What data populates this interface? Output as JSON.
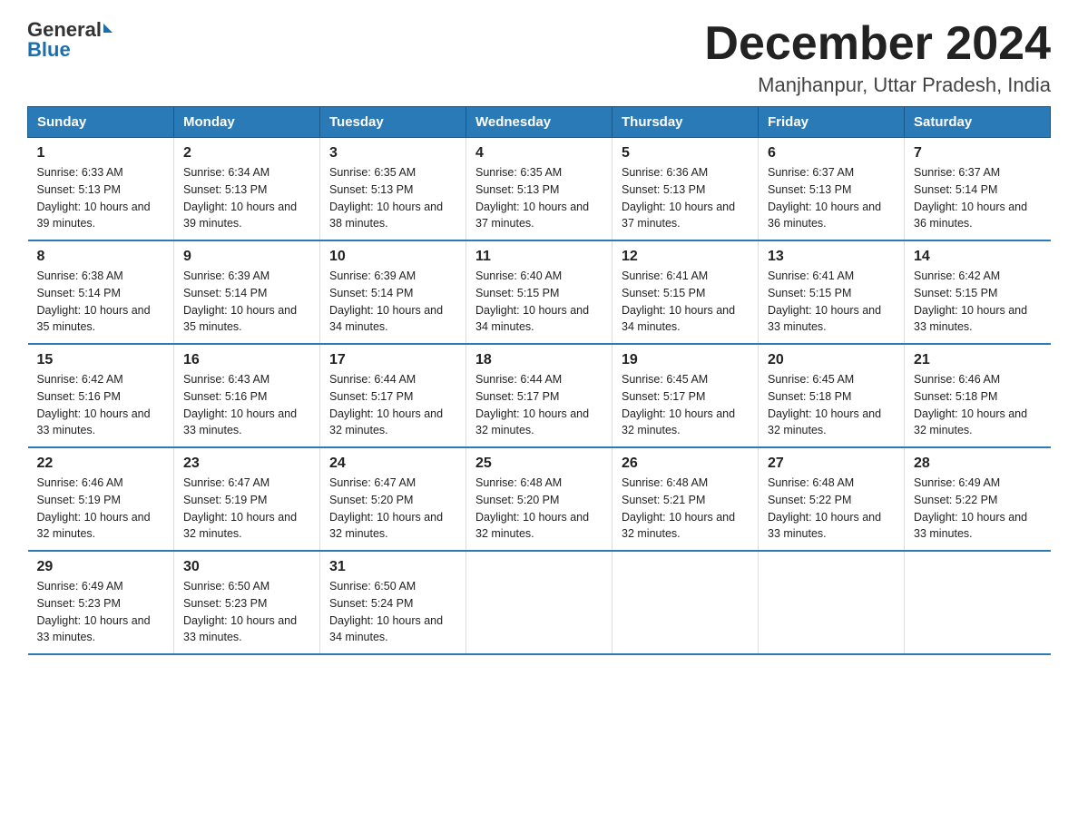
{
  "header": {
    "logo_general": "General",
    "logo_blue": "Blue",
    "month_title": "December 2024",
    "location": "Manjhanpur, Uttar Pradesh, India"
  },
  "days_of_week": [
    "Sunday",
    "Monday",
    "Tuesday",
    "Wednesday",
    "Thursday",
    "Friday",
    "Saturday"
  ],
  "weeks": [
    [
      {
        "day": "1",
        "sunrise": "6:33 AM",
        "sunset": "5:13 PM",
        "daylight": "10 hours and 39 minutes."
      },
      {
        "day": "2",
        "sunrise": "6:34 AM",
        "sunset": "5:13 PM",
        "daylight": "10 hours and 39 minutes."
      },
      {
        "day": "3",
        "sunrise": "6:35 AM",
        "sunset": "5:13 PM",
        "daylight": "10 hours and 38 minutes."
      },
      {
        "day": "4",
        "sunrise": "6:35 AM",
        "sunset": "5:13 PM",
        "daylight": "10 hours and 37 minutes."
      },
      {
        "day": "5",
        "sunrise": "6:36 AM",
        "sunset": "5:13 PM",
        "daylight": "10 hours and 37 minutes."
      },
      {
        "day": "6",
        "sunrise": "6:37 AM",
        "sunset": "5:13 PM",
        "daylight": "10 hours and 36 minutes."
      },
      {
        "day": "7",
        "sunrise": "6:37 AM",
        "sunset": "5:14 PM",
        "daylight": "10 hours and 36 minutes."
      }
    ],
    [
      {
        "day": "8",
        "sunrise": "6:38 AM",
        "sunset": "5:14 PM",
        "daylight": "10 hours and 35 minutes."
      },
      {
        "day": "9",
        "sunrise": "6:39 AM",
        "sunset": "5:14 PM",
        "daylight": "10 hours and 35 minutes."
      },
      {
        "day": "10",
        "sunrise": "6:39 AM",
        "sunset": "5:14 PM",
        "daylight": "10 hours and 34 minutes."
      },
      {
        "day": "11",
        "sunrise": "6:40 AM",
        "sunset": "5:15 PM",
        "daylight": "10 hours and 34 minutes."
      },
      {
        "day": "12",
        "sunrise": "6:41 AM",
        "sunset": "5:15 PM",
        "daylight": "10 hours and 34 minutes."
      },
      {
        "day": "13",
        "sunrise": "6:41 AM",
        "sunset": "5:15 PM",
        "daylight": "10 hours and 33 minutes."
      },
      {
        "day": "14",
        "sunrise": "6:42 AM",
        "sunset": "5:15 PM",
        "daylight": "10 hours and 33 minutes."
      }
    ],
    [
      {
        "day": "15",
        "sunrise": "6:42 AM",
        "sunset": "5:16 PM",
        "daylight": "10 hours and 33 minutes."
      },
      {
        "day": "16",
        "sunrise": "6:43 AM",
        "sunset": "5:16 PM",
        "daylight": "10 hours and 33 minutes."
      },
      {
        "day": "17",
        "sunrise": "6:44 AM",
        "sunset": "5:17 PM",
        "daylight": "10 hours and 32 minutes."
      },
      {
        "day": "18",
        "sunrise": "6:44 AM",
        "sunset": "5:17 PM",
        "daylight": "10 hours and 32 minutes."
      },
      {
        "day": "19",
        "sunrise": "6:45 AM",
        "sunset": "5:17 PM",
        "daylight": "10 hours and 32 minutes."
      },
      {
        "day": "20",
        "sunrise": "6:45 AM",
        "sunset": "5:18 PM",
        "daylight": "10 hours and 32 minutes."
      },
      {
        "day": "21",
        "sunrise": "6:46 AM",
        "sunset": "5:18 PM",
        "daylight": "10 hours and 32 minutes."
      }
    ],
    [
      {
        "day": "22",
        "sunrise": "6:46 AM",
        "sunset": "5:19 PM",
        "daylight": "10 hours and 32 minutes."
      },
      {
        "day": "23",
        "sunrise": "6:47 AM",
        "sunset": "5:19 PM",
        "daylight": "10 hours and 32 minutes."
      },
      {
        "day": "24",
        "sunrise": "6:47 AM",
        "sunset": "5:20 PM",
        "daylight": "10 hours and 32 minutes."
      },
      {
        "day": "25",
        "sunrise": "6:48 AM",
        "sunset": "5:20 PM",
        "daylight": "10 hours and 32 minutes."
      },
      {
        "day": "26",
        "sunrise": "6:48 AM",
        "sunset": "5:21 PM",
        "daylight": "10 hours and 32 minutes."
      },
      {
        "day": "27",
        "sunrise": "6:48 AM",
        "sunset": "5:22 PM",
        "daylight": "10 hours and 33 minutes."
      },
      {
        "day": "28",
        "sunrise": "6:49 AM",
        "sunset": "5:22 PM",
        "daylight": "10 hours and 33 minutes."
      }
    ],
    [
      {
        "day": "29",
        "sunrise": "6:49 AM",
        "sunset": "5:23 PM",
        "daylight": "10 hours and 33 minutes."
      },
      {
        "day": "30",
        "sunrise": "6:50 AM",
        "sunset": "5:23 PM",
        "daylight": "10 hours and 33 minutes."
      },
      {
        "day": "31",
        "sunrise": "6:50 AM",
        "sunset": "5:24 PM",
        "daylight": "10 hours and 34 minutes."
      },
      null,
      null,
      null,
      null
    ]
  ]
}
